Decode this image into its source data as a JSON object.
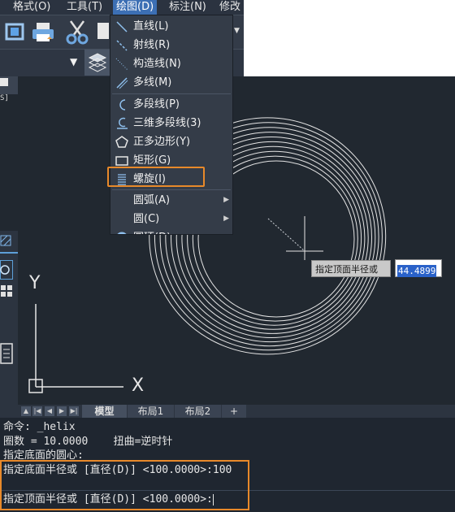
{
  "menubar": {
    "items": [
      "格式(O)",
      "工具(T)",
      "绘图(D)",
      "标注(N)",
      "修改"
    ]
  },
  "draw_menu": {
    "items": [
      {
        "label": "直线(L)",
        "icon": "line-icon"
      },
      {
        "label": "射线(R)",
        "icon": "ray-icon"
      },
      {
        "label": "构造线(N)",
        "icon": "construction-line-icon"
      },
      {
        "label": "多线(M)",
        "icon": "multiline-icon"
      },
      {
        "label": "多段线(P)",
        "icon": "polyline-icon"
      },
      {
        "label": "三维多段线(3)",
        "icon": "3d-polyline-icon"
      },
      {
        "label": "正多边形(Y)",
        "icon": "polygon-icon"
      },
      {
        "label": "矩形(G)",
        "icon": "rectangle-icon"
      },
      {
        "label": "螺旋(I)",
        "icon": "helix-icon"
      },
      {
        "label": "圆弧(A)",
        "icon": "",
        "submenu": true
      },
      {
        "label": "圆(C)",
        "icon": "",
        "submenu": true
      },
      {
        "label": "圆环(D)",
        "icon": "donut-icon"
      }
    ]
  },
  "layout_tabs": {
    "items": [
      "模型",
      "布局1",
      "布局2",
      "+"
    ],
    "active": "模型"
  },
  "ucs": {
    "x_label": "X",
    "y_label": "Y"
  },
  "dynamic_input": {
    "prompt": "指定顶面半径或",
    "value": "44.4899"
  },
  "command_line": {
    "lines": [
      "命令: _helix",
      "圈数 = 10.0000    扭曲=逆时针",
      "指定底面的圆心:",
      "指定底面半径或 [直径(D)] <100.0000>:100",
      "指定顶面半径或 [直径(D)] <100.0000>:"
    ]
  },
  "colors": {
    "accent_highlight": "#e8892a",
    "menu_active": "#3c6fb4",
    "canvas_bg": "#212830"
  }
}
